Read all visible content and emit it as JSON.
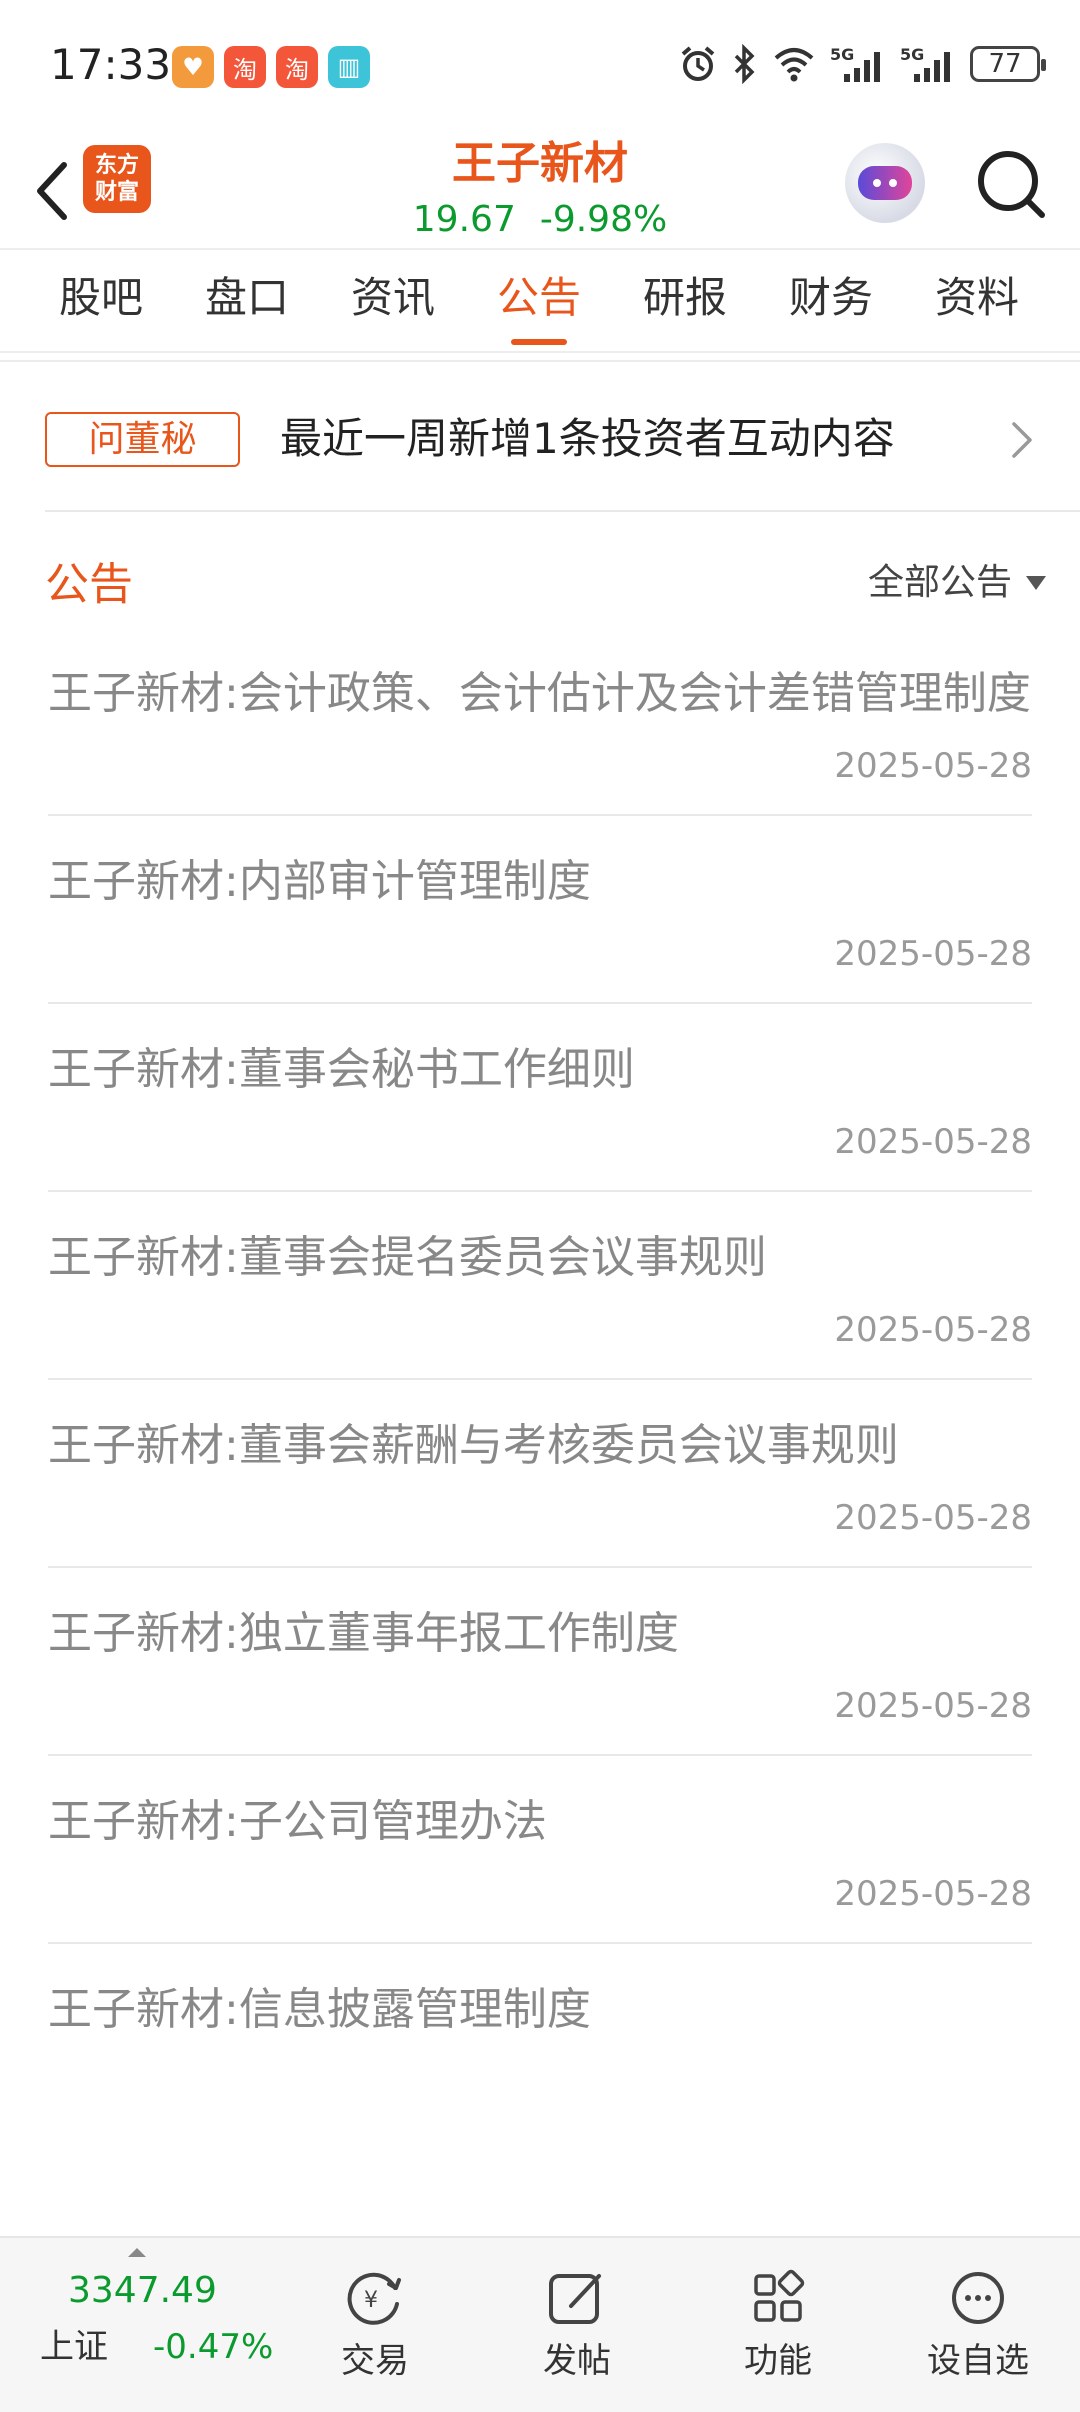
{
  "status_bar": {
    "time": "17:33",
    "battery": "77"
  },
  "header": {
    "logo_text": "东方财富",
    "stock_name": "王子新材",
    "price": "19.67",
    "change_pct": "-9.98%"
  },
  "tabs": [
    {
      "label": "股吧"
    },
    {
      "label": "盘口"
    },
    {
      "label": "资讯"
    },
    {
      "label": "公告",
      "active": true
    },
    {
      "label": "研报"
    },
    {
      "label": "财务"
    },
    {
      "label": "资料"
    }
  ],
  "qa_banner": {
    "badge": "问董秘",
    "text": "最近一周新增1条投资者互动内容"
  },
  "announcements": {
    "section_title": "公告",
    "filter_label": "全部公告",
    "items": [
      {
        "title": "王子新材:会计政策、会计估计及会计差错管理制度",
        "date": "2025-05-28"
      },
      {
        "title": "王子新材:内部审计管理制度",
        "date": "2025-05-28"
      },
      {
        "title": "王子新材:董事会秘书工作细则",
        "date": "2025-05-28"
      },
      {
        "title": "王子新材:董事会提名委员会议事规则",
        "date": "2025-05-28"
      },
      {
        "title": "王子新材:董事会薪酬与考核委员会议事规则",
        "date": "2025-05-28"
      },
      {
        "title": "王子新材:独立董事年报工作制度",
        "date": "2025-05-28"
      },
      {
        "title": "王子新材:子公司管理办法",
        "date": "2025-05-28"
      },
      {
        "title": "王子新材:信息披露管理制度",
        "date": ""
      }
    ]
  },
  "bottom_nav": {
    "index_value": "3347.49",
    "index_name": "上证",
    "index_change": "-0.47%",
    "items": [
      {
        "label": "交易",
        "icon": "trade-icon"
      },
      {
        "label": "发帖",
        "icon": "post-icon"
      },
      {
        "label": "功能",
        "icon": "functions-icon"
      },
      {
        "label": "设自选",
        "icon": "add-watchlist-icon"
      }
    ]
  },
  "colors": {
    "accent": "#e8561c",
    "down_green": "#0a9a2e",
    "muted_text": "#888888"
  }
}
